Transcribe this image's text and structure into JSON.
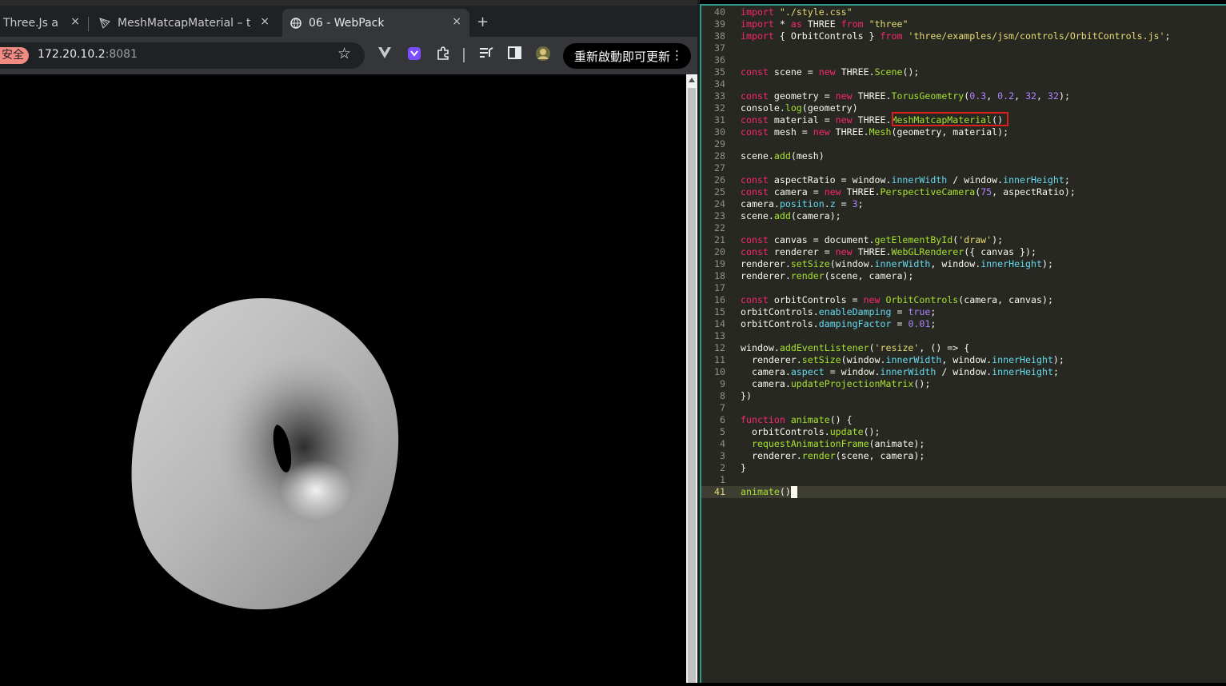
{
  "browser": {
    "tabs": [
      {
        "label": "Three.Js a",
        "close": "×"
      },
      {
        "label": "MeshMatcapMaterial – t",
        "close": "×"
      },
      {
        "label": "06 - WebPack",
        "close": "×"
      }
    ],
    "new_tab": "+",
    "toolbar": {
      "security_badge": "安全",
      "url_host": "172.20.10.2",
      "url_port": ":8081",
      "update_button": "重新啟動即可更新",
      "menu": "⋮"
    }
  },
  "scene": {
    "object": "torus",
    "material_tone": "gray-matcap"
  },
  "editor": {
    "highlighted_text": "MeshMatcapMaterial()",
    "current_line": "41",
    "lines": [
      {
        "n": "40",
        "t": "import \"./style.css\""
      },
      {
        "n": "39",
        "t": "import * as THREE from \"three\""
      },
      {
        "n": "38",
        "t": "import { OrbitControls } from 'three/examples/jsm/controls/OrbitControls.js';"
      },
      {
        "n": "37",
        "t": ""
      },
      {
        "n": "36",
        "t": ""
      },
      {
        "n": "35",
        "t": "const scene = new THREE.Scene();"
      },
      {
        "n": "34",
        "t": ""
      },
      {
        "n": "33",
        "t": "const geometry = new THREE.TorusGeometry(0.3, 0.2, 32, 32);"
      },
      {
        "n": "32",
        "t": "console.log(geometry)"
      },
      {
        "n": "31",
        "t": "const material = new THREE.MeshMatcapMaterial()"
      },
      {
        "n": "30",
        "t": "const mesh = new THREE.Mesh(geometry, material);"
      },
      {
        "n": "29",
        "t": ""
      },
      {
        "n": "28",
        "t": "scene.add(mesh)"
      },
      {
        "n": "27",
        "t": ""
      },
      {
        "n": "26",
        "t": "const aspectRatio = window.innerWidth / window.innerHeight;"
      },
      {
        "n": "25",
        "t": "const camera = new THREE.PerspectiveCamera(75, aspectRatio);"
      },
      {
        "n": "24",
        "t": "camera.position.z = 3;"
      },
      {
        "n": "23",
        "t": "scene.add(camera);"
      },
      {
        "n": "22",
        "t": ""
      },
      {
        "n": "21",
        "t": "const canvas = document.getElementById('draw');"
      },
      {
        "n": "20",
        "t": "const renderer = new THREE.WebGLRenderer({ canvas });"
      },
      {
        "n": "19",
        "t": "renderer.setSize(window.innerWidth, window.innerHeight);"
      },
      {
        "n": "18",
        "t": "renderer.render(scene, camera);"
      },
      {
        "n": "17",
        "t": ""
      },
      {
        "n": "16",
        "t": "const orbitControls = new OrbitControls(camera, canvas);"
      },
      {
        "n": "15",
        "t": "orbitControls.enableDamping = true;"
      },
      {
        "n": "14",
        "t": "orbitControls.dampingFactor = 0.01;"
      },
      {
        "n": "13",
        "t": ""
      },
      {
        "n": "12",
        "t": "window.addEventListener('resize', () => {"
      },
      {
        "n": "11",
        "t": "  renderer.setSize(window.innerWidth, window.innerHeight);"
      },
      {
        "n": "10",
        "t": "  camera.aspect = window.innerWidth / window.innerHeight;"
      },
      {
        "n": "9",
        "t": "  camera.updateProjectionMatrix();"
      },
      {
        "n": "8",
        "t": "})"
      },
      {
        "n": "7",
        "t": ""
      },
      {
        "n": "6",
        "t": "function animate() {"
      },
      {
        "n": "5",
        "t": "  orbitControls.update();"
      },
      {
        "n": "4",
        "t": "  requestAnimationFrame(animate);"
      },
      {
        "n": "3",
        "t": "  renderer.render(scene, camera);"
      },
      {
        "n": "2",
        "t": "}"
      },
      {
        "n": "1",
        "t": ""
      },
      {
        "n": "41",
        "t": "animate();"
      }
    ]
  }
}
